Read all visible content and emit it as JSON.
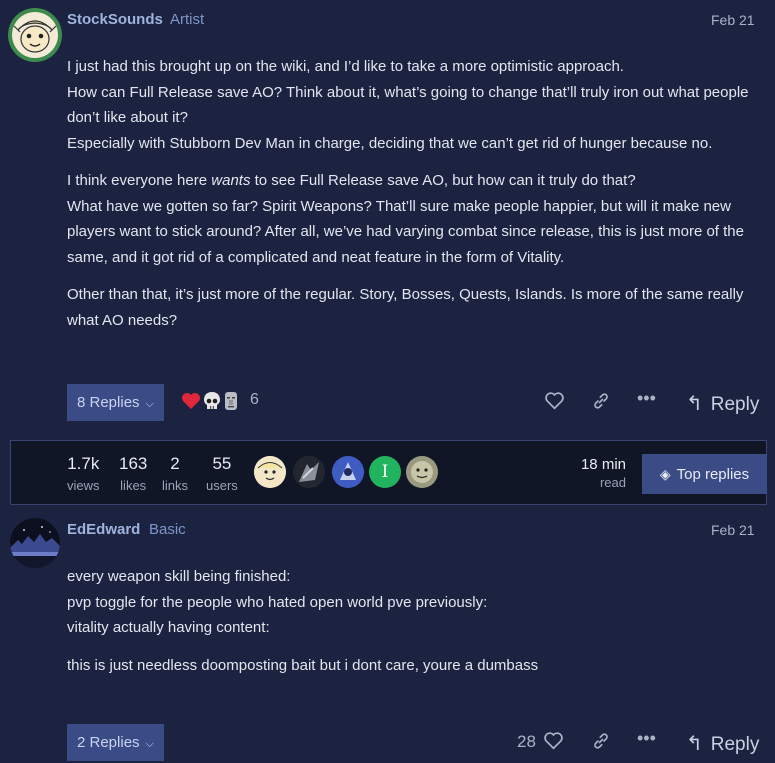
{
  "post1": {
    "username": "StockSounds",
    "user_title": "Artist",
    "date": "Feb 21",
    "paragraphs": [
      [
        "I just had this brought up on the wiki, and I’d like to take a more optimistic approach.",
        "How can Full Release save AO? Think about it, what’s going to change that’ll truly iron out what people don’t like about it?",
        "Especially with Stubborn Dev Man in charge, deciding that we can’t get rid of hunger because no."
      ],
      [
        "I think everyone here ",
        "wants",
        " to see Full Release save AO, but how can it truly do that?",
        "What have we gotten so far? Spirit Weapons? That’ll sure make people happier, but will it make new players want to stick around? After all, we’ve had varying combat since release, this is just more of the same, and it got rid of a complicated and neat feature in the form of Vitality."
      ],
      [
        "Other than that, it’s just more of the regular. Story, Bosses, Quests, Islands. Is more of the same really what AO needs?"
      ]
    ],
    "replies_label": "8 Replies",
    "reaction_count": "6",
    "reply_label": "Reply"
  },
  "topic_stats": {
    "views": {
      "num": "1.7k",
      "label": "views"
    },
    "likes": {
      "num": "163",
      "label": "likes"
    },
    "links": {
      "num": "2",
      "label": "links"
    },
    "users": {
      "num": "55",
      "label": "users"
    },
    "participant_initial": "I",
    "read_time": {
      "num": "18 min",
      "label": "read"
    },
    "top_replies_label": "Top replies"
  },
  "post2": {
    "username": "EdEdward",
    "user_title": "Basic",
    "date": "Feb 21",
    "lines": [
      "every weapon skill being finished:",
      "pvp toggle for the people who hated open world pve previously:",
      "vitality actually having content:"
    ],
    "last_line": "this is just needless doomposting bait but i dont care, youre a dumbass",
    "replies_label": "2 Replies",
    "like_count": "28",
    "reply_label": "Reply"
  },
  "colors": {
    "background": "#1c2340",
    "accent_button": "#3a4b86",
    "stats_bar": "#101626",
    "username": "#9fb3df"
  },
  "icons": [
    "heart-icon",
    "link-icon",
    "more-icon",
    "reply-arrow-icon",
    "chevron-down-icon",
    "layers-icon",
    "skull-emoji",
    "moai-emoji"
  ]
}
